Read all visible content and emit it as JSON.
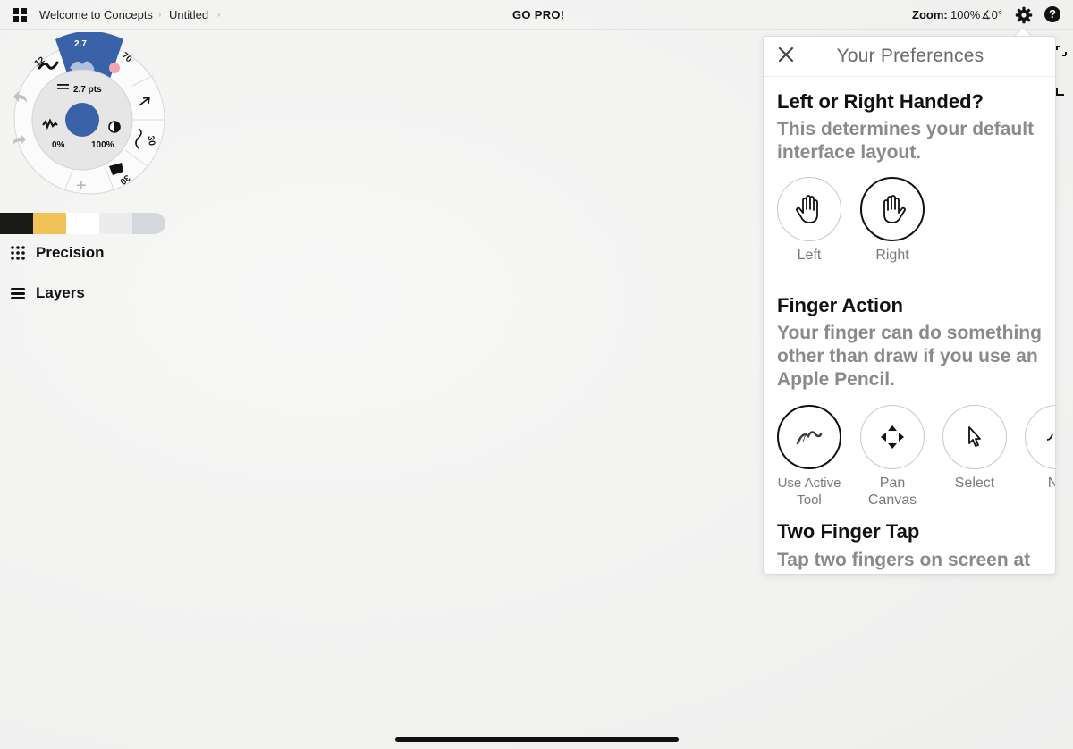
{
  "breadcrumb": {
    "home": "Welcome to Concepts",
    "current": "Untitled"
  },
  "header": {
    "promo": "GO PRO!",
    "zoom_label": "Zoom:",
    "zoom_value": "100%",
    "angle_value": "∡0°"
  },
  "tool_wheel": {
    "brush_size": "2.7",
    "size_readout": "2.7 pts",
    "left_value": "12",
    "right_value": "70",
    "smoothing_value": "30",
    "opacity_value": "30",
    "min_percent": "0%",
    "max_percent": "100%",
    "active_color": "#3a62a8",
    "add_symbol": "+"
  },
  "swatches": [
    "#1b1915",
    "#f1c257",
    "#ffffff",
    "#ececec",
    "#d4d8dc"
  ],
  "sidebar": {
    "precision_label": "Precision",
    "layers_label": "Layers"
  },
  "preferences": {
    "title": "Your Preferences",
    "handed": {
      "heading": "Left or Right Handed?",
      "description": "This determines your default interface layout.",
      "options": [
        {
          "label": "Left",
          "icon": "left-hand-icon",
          "selected": false
        },
        {
          "label": "Right",
          "icon": "right-hand-icon",
          "selected": true
        }
      ]
    },
    "finger_action": {
      "heading": "Finger Action",
      "description": "Your finger can do something other than draw if you use an Apple Pencil.",
      "options": [
        {
          "label": "Use Active Tool",
          "icon": "brush-stroke-icon",
          "selected": true
        },
        {
          "label": "Pan Canvas",
          "icon": "move-arrows-icon",
          "selected": false
        },
        {
          "label": "Select",
          "icon": "pointer-icon",
          "selected": false
        },
        {
          "label": "Nu",
          "icon": "nudge-icon",
          "selected": false
        }
      ]
    },
    "two_finger_tap": {
      "heading": "Two Finger Tap",
      "description": "Tap two fingers on screen at"
    }
  }
}
